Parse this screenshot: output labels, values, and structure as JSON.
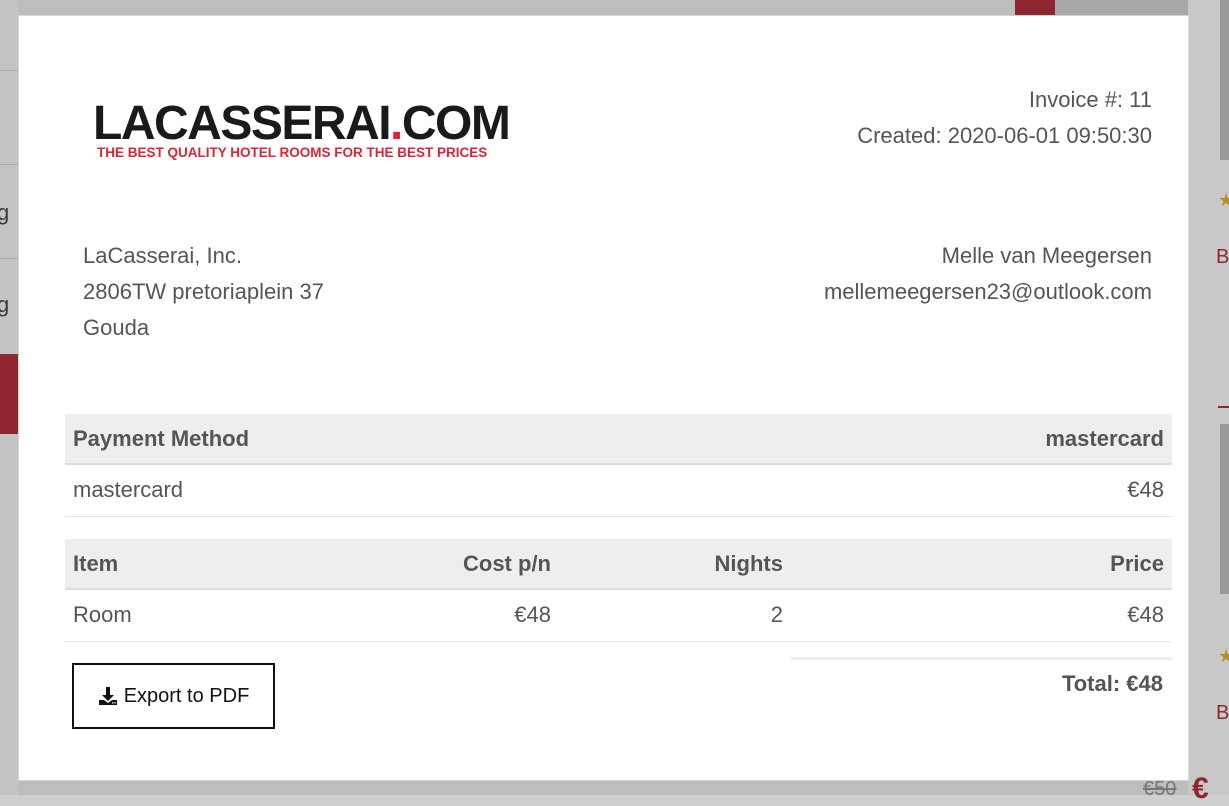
{
  "logo": {
    "main_before_dot": "LACASSERAI",
    "dot": ".",
    "main_after_dot": "COM",
    "tagline": "THE BEST QUALITY HOTEL ROOMS FOR THE BEST PRICES",
    "brand_color": "#d72638"
  },
  "invoice": {
    "number_text": "Invoice #: 11",
    "created_text": "Created: 2020-06-01 09:50:30"
  },
  "company": {
    "name": "LaCasserai, Inc.",
    "address": "2806TW pretoriaplein 37",
    "city": "Gouda"
  },
  "customer": {
    "name": "Melle van Meegersen",
    "email": "mellemeegersen23@outlook.com"
  },
  "payment": {
    "headers": [
      "Payment Method",
      "mastercard"
    ],
    "row": [
      "mastercard",
      "€48"
    ]
  },
  "items": {
    "headers": [
      "Item",
      "Cost p/n",
      "Nights",
      "Price"
    ],
    "rows": [
      [
        "Room",
        "€48",
        "2",
        "€48"
      ]
    ]
  },
  "total_text": "Total: €48",
  "export_button": {
    "label": "Export to PDF",
    "icon": "download-icon"
  },
  "background": {
    "left_texts": [
      "g",
      "g"
    ],
    "right_texts": [
      "B",
      "B"
    ],
    "old_price": "€50",
    "price_symbol": "€",
    "accent_color": "#8e2730"
  }
}
